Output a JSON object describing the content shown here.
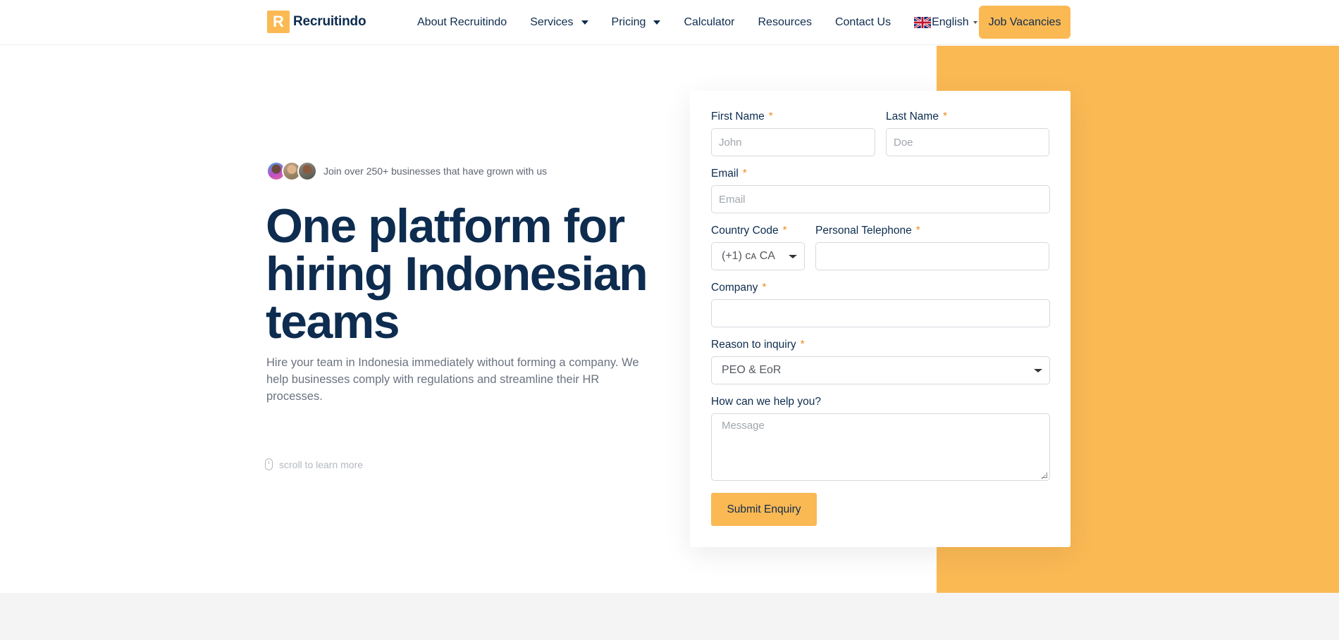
{
  "brand": {
    "logo_letter": "R",
    "name": "Recruitindo",
    "accent_color": "#fbb954",
    "text_color": "#0d2c4f"
  },
  "nav": {
    "items": [
      {
        "label": "About Recruitindo",
        "dropdown": false
      },
      {
        "label": "Services",
        "dropdown": true
      },
      {
        "label": "Pricing",
        "dropdown": true
      },
      {
        "label": "Calculator",
        "dropdown": false
      },
      {
        "label": "Resources",
        "dropdown": false
      },
      {
        "label": "Contact Us",
        "dropdown": false
      }
    ],
    "language": {
      "label": "English",
      "flag_icon": "uk-flag-icon"
    },
    "cta": "Job Vacancies"
  },
  "hero": {
    "social_proof": "Join over 250+ businesses that have grown with us",
    "headline": "One platform for hiring Indonesian teams",
    "subtext": "Hire your team in Indonesia immediately without forming a company. We help businesses comply with regulations and streamline their HR processes.",
    "scroll_hint": "scroll to learn more"
  },
  "form": {
    "first_name": {
      "label": "First Name",
      "required": "*",
      "placeholder": "John"
    },
    "last_name": {
      "label": "Last Name",
      "required": "*",
      "placeholder": "Doe"
    },
    "email": {
      "label": "Email",
      "required": "*",
      "placeholder": "Email"
    },
    "country_code": {
      "label": "Country Code",
      "required": "*",
      "value": "(+1) ᴄᴀ CA"
    },
    "telephone": {
      "label": "Personal Telephone",
      "required": "*",
      "placeholder": ""
    },
    "company": {
      "label": "Company",
      "required": "*",
      "placeholder": ""
    },
    "reason": {
      "label": "Reason to inquiry",
      "required": "*",
      "value": "PEO & EoR"
    },
    "message": {
      "label": "How can we help you?",
      "placeholder": "Message"
    },
    "submit": "Submit Enquiry"
  }
}
